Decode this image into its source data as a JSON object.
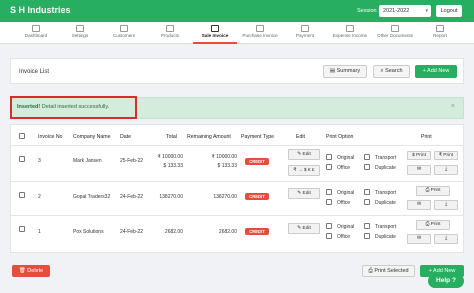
{
  "header": {
    "brand": "S H Industries",
    "session_label": "Session :",
    "session_value": "2021-2022",
    "logout_label": "Logout"
  },
  "nav": {
    "tabs": [
      {
        "label": "Dashboard",
        "icon": "dashboard-icon"
      },
      {
        "label": "Settings",
        "icon": "settings-icon"
      },
      {
        "label": "Customers",
        "icon": "customers-icon"
      },
      {
        "label": "Products",
        "icon": "products-icon"
      },
      {
        "label": "Sale Invoice",
        "icon": "sale-invoice-icon"
      },
      {
        "label": "Purchase Invoice",
        "icon": "purchase-invoice-icon"
      },
      {
        "label": "Payment",
        "icon": "payment-icon"
      },
      {
        "label": "Expense Income",
        "icon": "expense-icon"
      },
      {
        "label": "Other Documents",
        "icon": "documents-icon"
      },
      {
        "label": "Report",
        "icon": "report-icon"
      }
    ],
    "active": "Sale Invoice"
  },
  "toolbar": {
    "title": "Invoice List",
    "summary_label": "Summary",
    "search_label": "Search",
    "add_new_label": "+ Add New"
  },
  "alert": {
    "strong": "Inserted!",
    "message": "Detail inserted successfully.",
    "close": "×"
  },
  "table": {
    "headers": [
      "Invoice No",
      "Company Name",
      "Date",
      "Total",
      "Remaining Amount",
      "Payment Type",
      "Edit",
      "Print Option",
      "Print"
    ],
    "rows": [
      {
        "invoice_no": "3",
        "company": "Mark Jansen",
        "date": "25-Feb-22",
        "total_1": "₹ 10000.00",
        "total_2": "$ 133.33",
        "remaining_1": "₹ 10000.00",
        "remaining_2": "$ 133.33",
        "payment_type": "CREDIT",
        "edit_label": "Edit",
        "convert_label": "₹ → $ € £",
        "print_labels": [
          "$ Print",
          "₹ Print"
        ]
      },
      {
        "invoice_no": "2",
        "company": "Gopal Traders32",
        "date": "24-Feb-22",
        "total_1": "138270.00",
        "total_2": "",
        "remaining_1": "138270.00",
        "remaining_2": "",
        "payment_type": "CREDIT",
        "edit_label": "Edit",
        "convert_label": "",
        "print_labels": [
          "Print"
        ]
      },
      {
        "invoice_no": "1",
        "company": "Pox Solutions",
        "date": "24-Feb-22",
        "total_1": "2682.00",
        "total_2": "",
        "remaining_1": "2682.00",
        "remaining_2": "",
        "payment_type": "CREDIT",
        "edit_label": "Edit",
        "convert_label": "",
        "print_labels": [
          "Print"
        ]
      }
    ],
    "print_options": [
      "Original",
      "Transport",
      "Office",
      "Duplicate"
    ]
  },
  "footer": {
    "delete_label": "Delete",
    "print_selected_label": "Print Selected",
    "add_new_label": "+ Add New",
    "help_label": "Help"
  },
  "colors": {
    "brand": "#27ae60",
    "danger": "#e74c3c",
    "alert_bg": "#d4ecdc"
  }
}
